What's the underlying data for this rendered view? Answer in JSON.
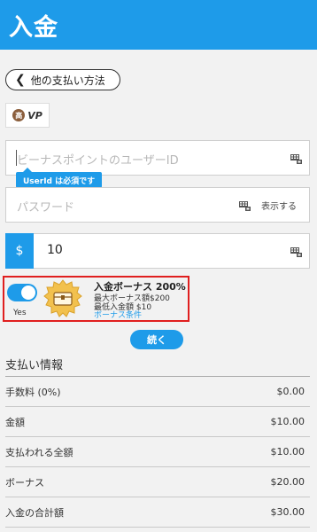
{
  "header": {
    "title": "入金"
  },
  "back_button": {
    "label": "他の支払い方法"
  },
  "logo": {
    "coin_text": "高",
    "brand_text": "VP"
  },
  "userid_field": {
    "placeholder": "ビーナスポイントのユーザーID",
    "tooltip": "UserId は必須です"
  },
  "password_field": {
    "placeholder": "パスワード",
    "show_label": "表示する"
  },
  "amount_field": {
    "currency": "$",
    "value": "10"
  },
  "bonus": {
    "toggle_label": "Yes",
    "title": "入金ボーナス 200%",
    "max_bonus": "最大ボーナス額$200",
    "min_deposit": "最低入金額 $10",
    "conditions_link": "ボーナス条件"
  },
  "continue_button": {
    "label": "続く"
  },
  "payment_info": {
    "title": "支払い情報",
    "rows": [
      {
        "label": "手数料 (0%)",
        "value": "$0.00"
      },
      {
        "label": "金額",
        "value": "$10.00"
      },
      {
        "label": "支払われる全額",
        "value": "$10.00"
      },
      {
        "label": "ボーナス",
        "value": "$20.00"
      },
      {
        "label": "入金の合計額",
        "value": "$30.00"
      }
    ]
  },
  "colors": {
    "accent": "#1e9be9",
    "highlight_border": "#e01f1f"
  },
  "icons": {
    "keyboard": "keyboard-icon",
    "back": "chevron-left-icon",
    "chest": "treasure-chest-icon"
  }
}
